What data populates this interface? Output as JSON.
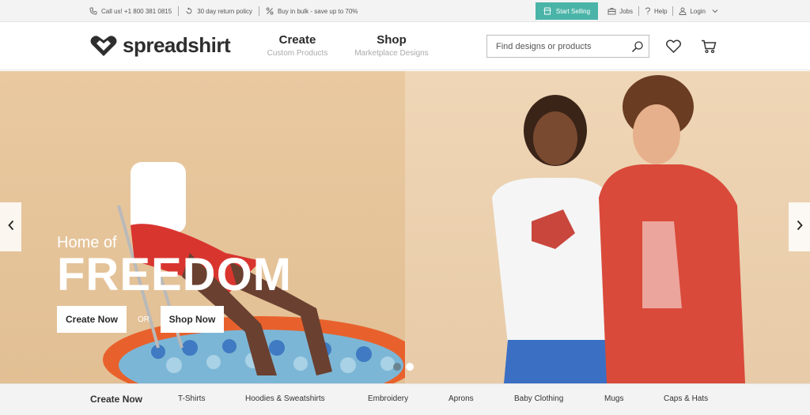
{
  "topbar": {
    "call": "Call us! +1 800 381 0815",
    "returns": "30 day return policy",
    "bulk": "Buy in bulk - save up to 70%",
    "start_selling": "Start Selling",
    "jobs": "Jobs",
    "help": "Help",
    "login": "Login"
  },
  "header": {
    "logo": "spreadshirt",
    "nav": [
      {
        "title": "Create",
        "subtitle": "Custom Products"
      },
      {
        "title": "Shop",
        "subtitle": "Marketplace Designs"
      }
    ],
    "search_placeholder": "Find designs or products"
  },
  "hero": {
    "subtitle": "Home of",
    "title": "FREEDOM",
    "cta_create": "Create Now",
    "or": "OR",
    "cta_shop": "Shop Now",
    "slides_total": 2,
    "active_slide": 1
  },
  "categories": [
    "Create Now",
    "T-Shirts",
    "Hoodies & Sweatshirts",
    "Embroidery",
    "Aprons",
    "Baby Clothing",
    "Mugs",
    "Caps & Hats"
  ],
  "colors": {
    "accent": "#4bb4a8",
    "topbar_bg": "#f3f3f3",
    "hero_left": "#e9c9a0",
    "hero_right": "#efd6b6"
  }
}
